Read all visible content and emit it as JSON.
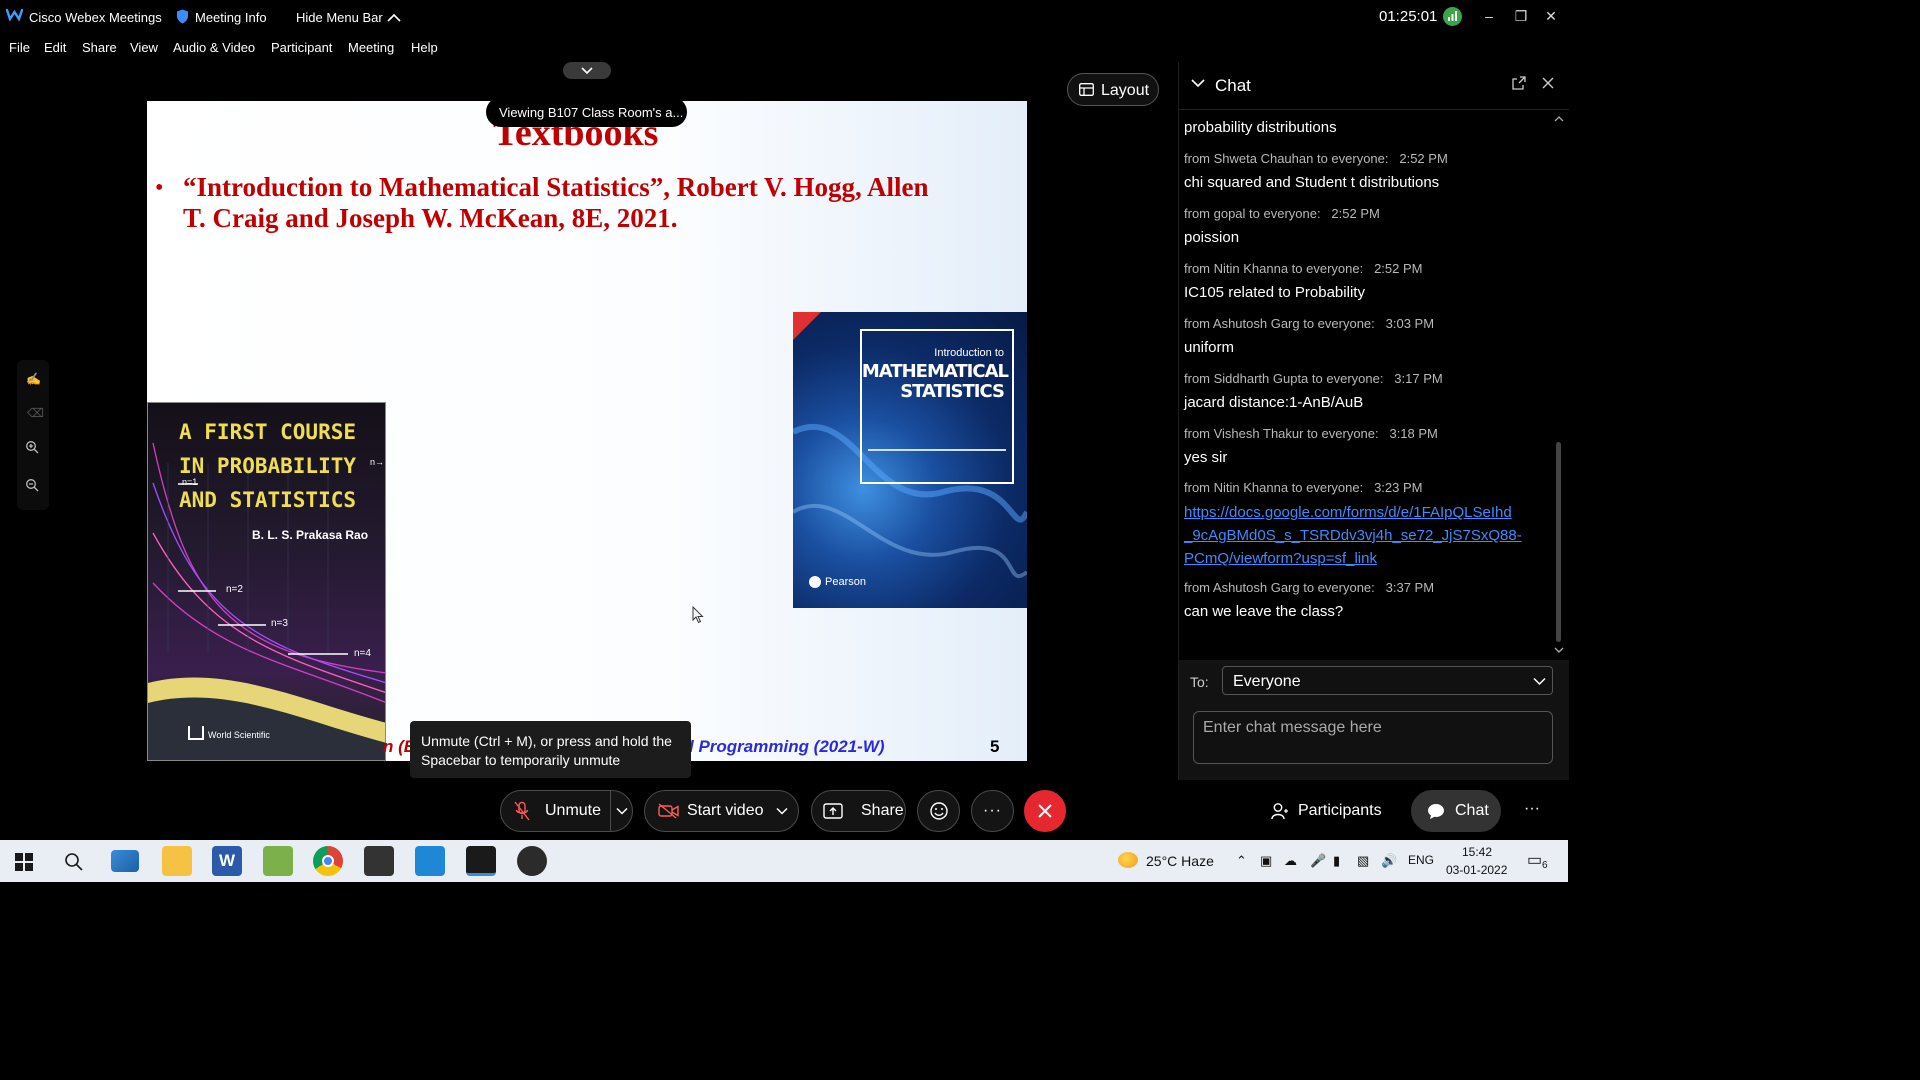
{
  "window": {
    "app_title": "Cisco Webex Meetings",
    "meeting_info": "Meeting Info",
    "hide_menu_bar": "Hide Menu Bar",
    "timer": "01:25:01"
  },
  "menu": [
    "File",
    "Edit",
    "Share",
    "View",
    "Audio & Video",
    "Participant",
    "Meeting",
    "Help"
  ],
  "stage": {
    "viewing_label": "Viewing B107 Class Room's a...",
    "layout_button": "Layout"
  },
  "slide": {
    "title": "Textbooks",
    "bullet_line1": "“Introduction to Mathematical Statistics”, Robert V. Hogg, Allen",
    "bullet_line2": "T. Craig and Joseph W. McKean, 8E, 2021.",
    "footer_left": "n (E",
    "footer_mid": "l Programming (2021-W)",
    "page_number": "5",
    "book1": {
      "title_line1": "A FIRST COURSE",
      "title_line2": "IN PROBABILITY",
      "title_line3": "AND STATISTICS",
      "author": "B. L. S. Prakasa Rao",
      "n1": "n=1",
      "n2": "n=2",
      "n3": "n=3",
      "n4": "n=4",
      "ninf": "n→",
      "publisher": "World Scientific"
    },
    "book2": {
      "title_line1": "Introduction to",
      "title_line2": "MATHEMATICAL",
      "title_line3": "STATISTICS",
      "publisher": "Pearson"
    }
  },
  "tooltip": {
    "line1": "Unmute (Ctrl + M), or press and hold the",
    "line2": "Spacebar to temporarily unmute"
  },
  "chat": {
    "title": "Chat",
    "top_partial": "probability distributions",
    "messages": [
      {
        "from": "from Shweta Chauhan to everyone:",
        "time": "2:52 PM",
        "text": "chi squared and Student t distributions"
      },
      {
        "from": "from gopal to everyone:",
        "time": "2:52 PM",
        "text": "poission"
      },
      {
        "from": "from Nitin Khanna to everyone:",
        "time": "2:52 PM",
        "text": "IC105 related to Probability"
      },
      {
        "from": "from Ashutosh Garg to everyone:",
        "time": "3:03 PM",
        "text": "uniform"
      },
      {
        "from": "from Siddharth Gupta to everyone:",
        "time": "3:17 PM",
        "text": "jacard distance:1-AnB/AuB"
      },
      {
        "from": "from Vishesh Thakur to everyone:",
        "time": "3:18 PM",
        "text": "yes sir"
      },
      {
        "from": "from Nitin Khanna to everyone:",
        "time": "3:23 PM",
        "link_line1": "https://docs.google.com/forms/d/e/1FAIpQLSeIhd",
        "link_line2": "_9cAgBMd0S_s_TSRDdv3vj4h_se72_JjS7SxQ88-",
        "link_line3": "PCmQ/viewform?usp=sf_link"
      },
      {
        "from": "from Ashutosh Garg to everyone:",
        "time": "3:37 PM",
        "text": "can we leave the class?"
      }
    ],
    "to_label": "To:",
    "recipient": "Everyone",
    "input_placeholder": "Enter chat message here"
  },
  "toolbar": {
    "unmute": "Unmute",
    "start_video": "Start video",
    "share": "Share",
    "participants": "Participants",
    "chat": "Chat",
    "more": "···"
  },
  "taskbar": {
    "weather": "25°C  Haze",
    "lang": "ENG",
    "time": "15:42",
    "date": "03-01-2022",
    "notif_count": "6"
  },
  "colors": {
    "slide_red": "#c00000",
    "link_blue": "#3d8bff",
    "end_red": "#e5282f",
    "chat_active": "#333333"
  }
}
